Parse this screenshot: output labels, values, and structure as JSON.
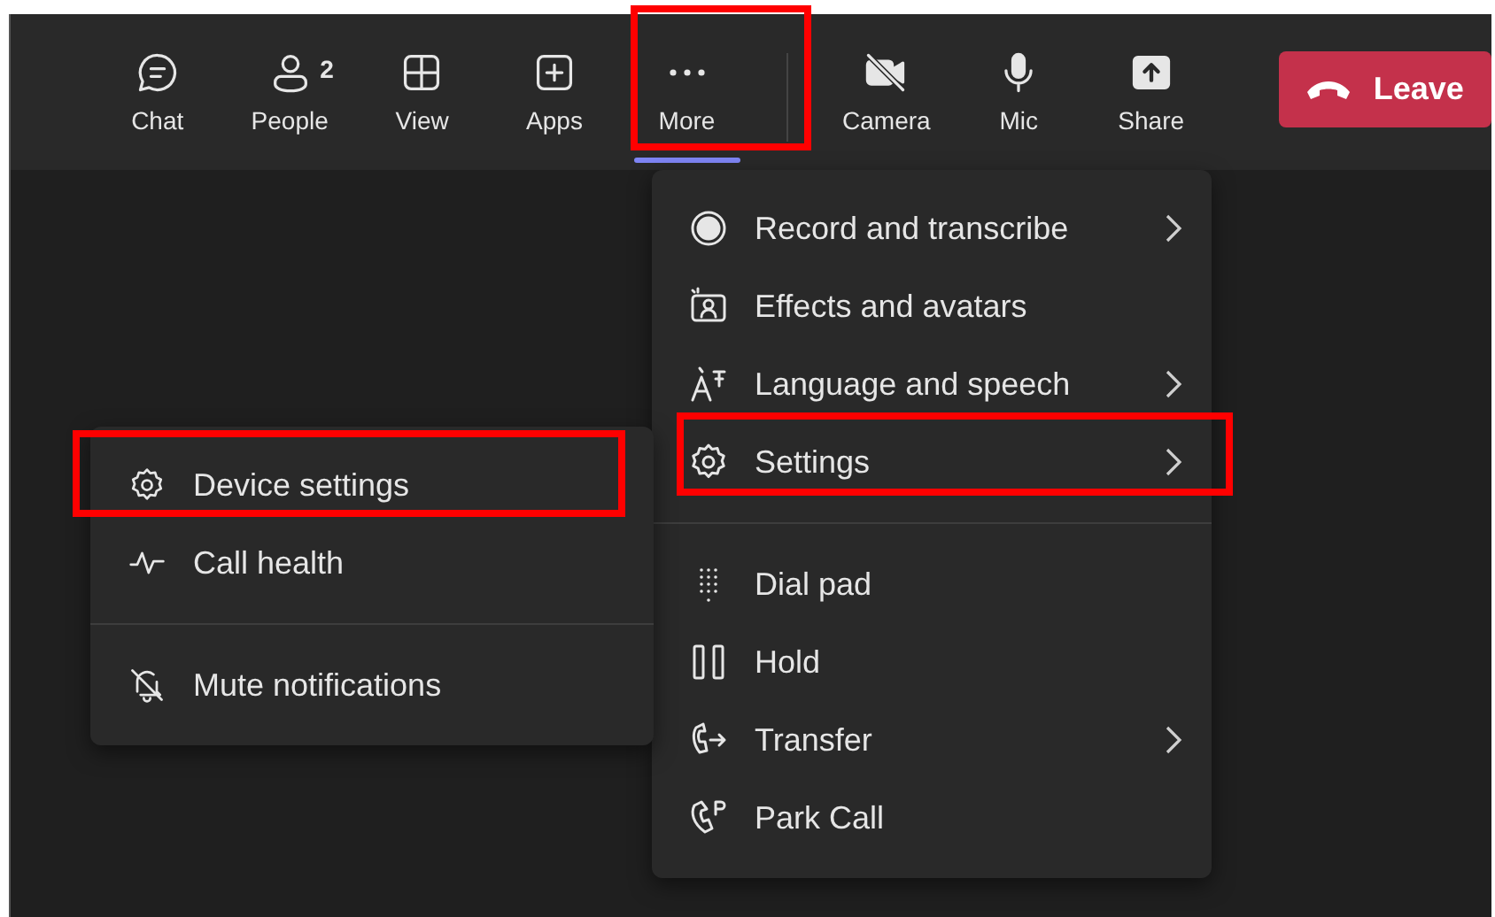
{
  "toolbar": {
    "buttons": [
      {
        "label": "Chat",
        "selected": false,
        "highlighted": false
      },
      {
        "label": "People",
        "badge": "2",
        "selected": false,
        "highlighted": false
      },
      {
        "label": "View",
        "selected": false,
        "highlighted": false
      },
      {
        "label": "Apps",
        "selected": false,
        "highlighted": false
      },
      {
        "label": "More",
        "selected": true,
        "highlighted": true
      },
      {
        "label": "Camera",
        "selected": false,
        "highlighted": false
      },
      {
        "label": "Mic",
        "selected": false,
        "highlighted": false
      },
      {
        "label": "Share",
        "selected": false,
        "highlighted": false
      }
    ],
    "leave_button": "Leave"
  },
  "more_menu": {
    "groups": [
      [
        {
          "label": "Record and transcribe",
          "submenu": true,
          "highlighted": false
        },
        {
          "label": "Effects and avatars",
          "submenu": false,
          "highlighted": false
        },
        {
          "label": "Language and speech",
          "submenu": true,
          "highlighted": false
        },
        {
          "label": "Settings",
          "submenu": true,
          "highlighted": true
        }
      ],
      [
        {
          "label": "Dial pad",
          "submenu": false,
          "highlighted": false
        },
        {
          "label": "Hold",
          "submenu": false,
          "highlighted": false
        },
        {
          "label": "Transfer",
          "submenu": true,
          "highlighted": false
        },
        {
          "label": "Park Call",
          "submenu": false,
          "highlighted": false
        }
      ]
    ]
  },
  "settings_menu": {
    "groups": [
      [
        {
          "label": "Device settings",
          "highlighted": true
        },
        {
          "label": "Call health",
          "highlighted": false
        }
      ],
      [
        {
          "label": "Mute notifications",
          "highlighted": false
        }
      ]
    ]
  }
}
